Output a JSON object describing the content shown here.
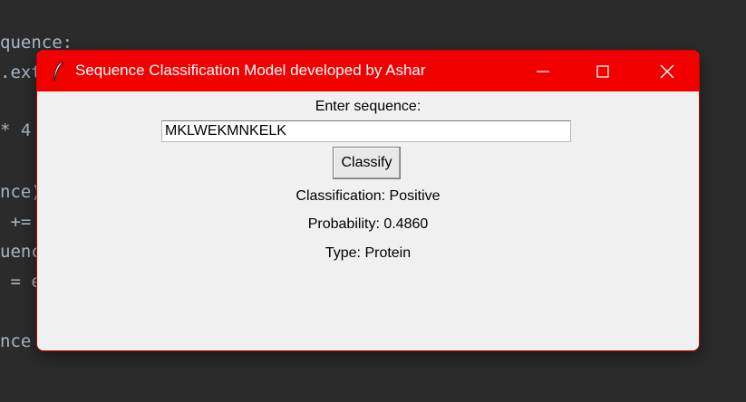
{
  "editor": {
    "lines": [
      "quence:",
      ".ext",
      "* 4",
      "nce)",
      " +=",
      "uenc",
      " = e",
      "nce"
    ]
  },
  "window": {
    "title": "Sequence Classification Model developed by Ashar",
    "controls": {
      "minimize": "minimize",
      "maximize": "maximize",
      "close": "close"
    },
    "colors": {
      "titlebar": "#f20000",
      "body": "#f0f0f0"
    }
  },
  "form": {
    "prompt_label": "Enter sequence:",
    "sequence_value": "MKLWEKMNKELK",
    "classify_label": "Classify"
  },
  "results": {
    "classification": "Classification: Positive",
    "probability": "Probability: 0.4860",
    "type": "Type: Protein"
  }
}
